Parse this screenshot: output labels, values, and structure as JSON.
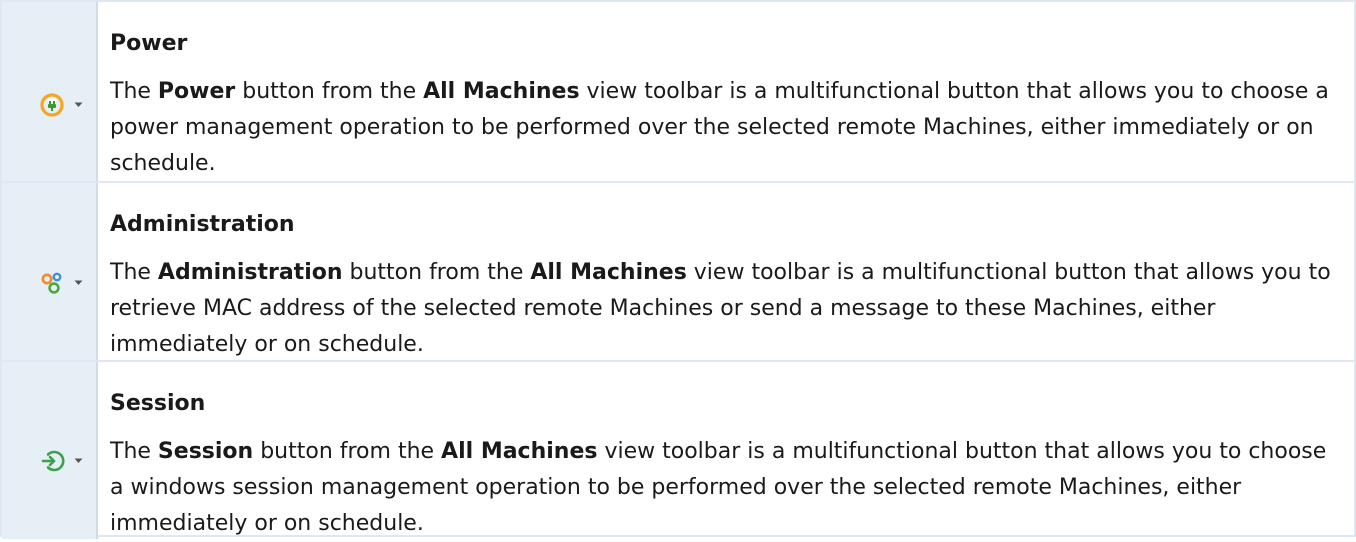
{
  "rows": [
    {
      "icon": "power-plug-icon",
      "heading": "Power",
      "desc": {
        "p1": "The ",
        "b1": "Power",
        "p2": " button from the ",
        "b2": "All Machines",
        "p3": " view toolbar is a multifunctional button that allows you to choose a power management operation to be performed over the selected remote Machines, either immediately or on schedule."
      }
    },
    {
      "icon": "administration-gears-icon",
      "heading": "Administration",
      "desc": {
        "p1": "The ",
        "b1": "Administration",
        "p2": " button from the ",
        "b2": "All Machines",
        "p3": " view toolbar is a multifunctional button that allows you to retrieve MAC address of the selected remote Machines or send a message to these Machines, either immediately or on schedule."
      }
    },
    {
      "icon": "session-login-icon",
      "heading": "Session",
      "desc": {
        "p1": "The ",
        "b1": "Session",
        "p2": " button from the ",
        "b2": "All Machines",
        "p3": " view toolbar is a multifunctional button that allows you to choose a windows session management operation to be performed over the selected remote Machines, either immediately or on schedule."
      }
    }
  ],
  "colors": {
    "icon_column_bg": "#e6eef6",
    "border": "#dfe8f2",
    "power_orange": "#f5a623",
    "power_green": "#3a9a2a",
    "admin_orange": "#f08c2a",
    "admin_blue": "#3d8fd6",
    "admin_green": "#48a83a",
    "session_green": "#3aa24a"
  }
}
